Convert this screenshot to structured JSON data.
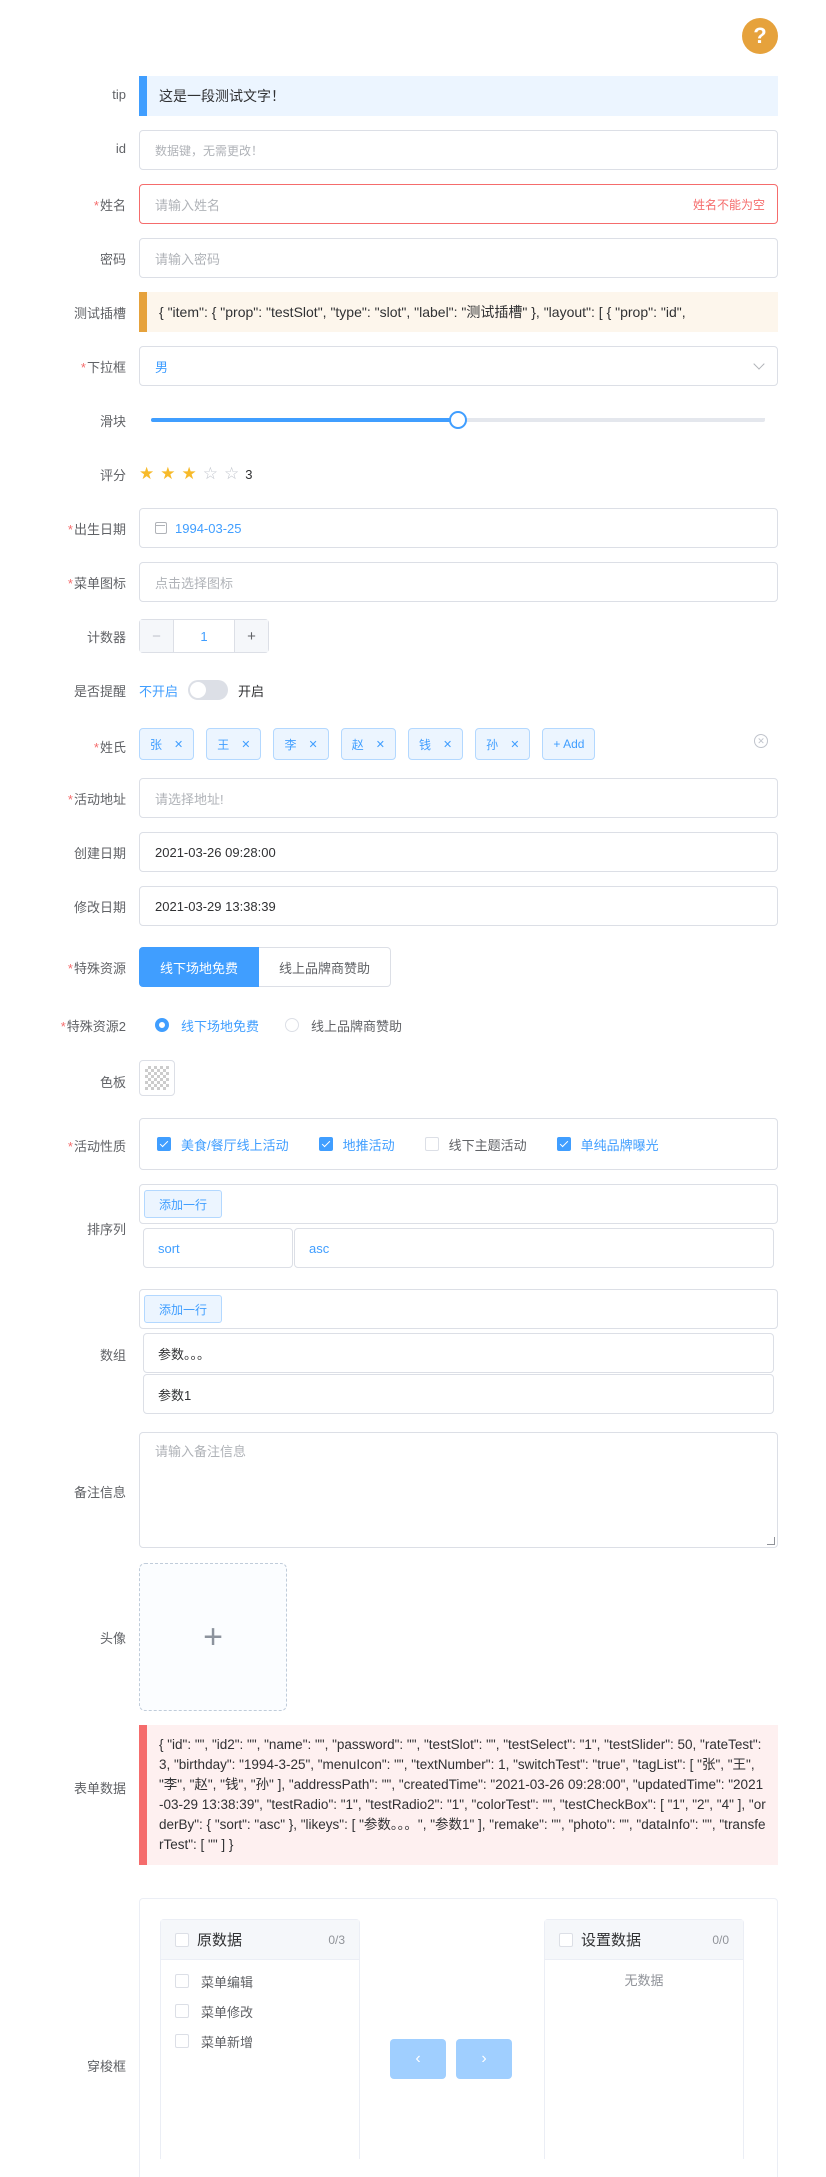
{
  "help_icon": "question-icon",
  "form": {
    "tip": {
      "label": "tip",
      "text": "这是一段测试文字！"
    },
    "id": {
      "label": "id",
      "placeholder": "数据键，无需更改！"
    },
    "name": {
      "label": "姓名",
      "placeholder": "请输入姓名",
      "error": "姓名不能为空"
    },
    "password": {
      "label": "密码",
      "placeholder": "请输入密码"
    },
    "test_slot": {
      "label": "测试插槽",
      "text": "{ \"item\": { \"prop\": \"testSlot\", \"type\": \"slot\", \"label\": \"测试插槽\" }, \"layout\": [ { \"prop\": \"id\","
    },
    "select": {
      "label": "下拉框",
      "value": "男"
    },
    "slider": {
      "label": "滑块",
      "value": 50,
      "max": 100
    },
    "rate": {
      "label": "评分",
      "value": 3,
      "max": 5,
      "text": "3"
    },
    "birthday": {
      "label": "出生日期",
      "value": "1994-03-25"
    },
    "menu_icon": {
      "label": "菜单图标",
      "placeholder": "点击选择图标"
    },
    "counter": {
      "label": "计数器",
      "value": "1",
      "minus": "−",
      "plus": "+"
    },
    "switch": {
      "label": "是否提醒",
      "off_text": "不开启",
      "on_text": "开启"
    },
    "tags": {
      "label": "姓氏",
      "items": [
        "张",
        "王",
        "李",
        "赵",
        "钱",
        "孙"
      ],
      "add": "+ Add"
    },
    "address": {
      "label": "活动地址",
      "placeholder": "请选择地址!"
    },
    "created": {
      "label": "创建日期",
      "value": "2021-03-26 09:28:00"
    },
    "updated": {
      "label": "修改日期",
      "value": "2021-03-29 13:38:39"
    },
    "radio_button": {
      "label": "特殊资源",
      "options": [
        "线下场地免费",
        "线上品牌商赞助"
      ],
      "selected": 0
    },
    "radio2": {
      "label": "特殊资源2",
      "options": [
        "线下场地免费",
        "线上品牌商赞助"
      ],
      "selected": 0
    },
    "color": {
      "label": "色板"
    },
    "checkbox": {
      "label": "活动性质",
      "options": [
        "美食/餐厅线上活动",
        "地推活动",
        "线下主题活动",
        "单纯品牌曝光"
      ],
      "checked": [
        true,
        true,
        false,
        true
      ]
    },
    "order": {
      "label": "排序列",
      "add_btn": "添加一行",
      "key": "sort",
      "value": "asc"
    },
    "likeys": {
      "label": "数组",
      "add_btn": "添加一行",
      "items": [
        "参数。。。",
        "参数1"
      ]
    },
    "remark": {
      "label": "备注信息",
      "placeholder": "请输入备注信息"
    },
    "photo": {
      "label": "头像",
      "plus": "+"
    },
    "form_data": {
      "label": "表单数据",
      "text": "{ \"id\": \"\", \"id2\": \"\", \"name\": \"\", \"password\": \"\", \"testSlot\": \"\", \"testSelect\": \"1\", \"testSlider\": 50, \"rateTest\": 3, \"birthday\": \"1994-3-25\", \"menuIcon\": \"\", \"textNumber\": 1, \"switchTest\": \"true\", \"tagList\": [ \"张\", \"王\", \"李\", \"赵\", \"钱\", \"孙\" ], \"addressPath\": \"\", \"createdTime\": \"2021-03-26 09:28:00\", \"updatedTime\": \"2021-03-29 13:38:39\", \"testRadio\": \"1\", \"testRadio2\": \"1\", \"colorTest\": \"\", \"testCheckBox\": [ \"1\", \"2\", \"4\" ], \"orderBy\": { \"sort\": \"asc\" }, \"likeys\": [ \"参数。。。\", \"参数1\" ], \"remake\": \"\", \"photo\": \"\", \"dataInfo\": \"\", \"transferTest\": [ \"\" ] }"
    },
    "transfer": {
      "label": "穿梭框",
      "left_title": "原数据",
      "left_count": "0/3",
      "left_items": [
        "菜单编辑",
        "菜单修改",
        "菜单新增"
      ],
      "right_title": "设置数据",
      "right_count": "0/0",
      "right_empty": "无数据",
      "to_left": "‹",
      "to_right": "›"
    }
  },
  "colors": {
    "primary": "#409eff",
    "danger": "#f56c6c",
    "warning": "#e6a23c"
  }
}
